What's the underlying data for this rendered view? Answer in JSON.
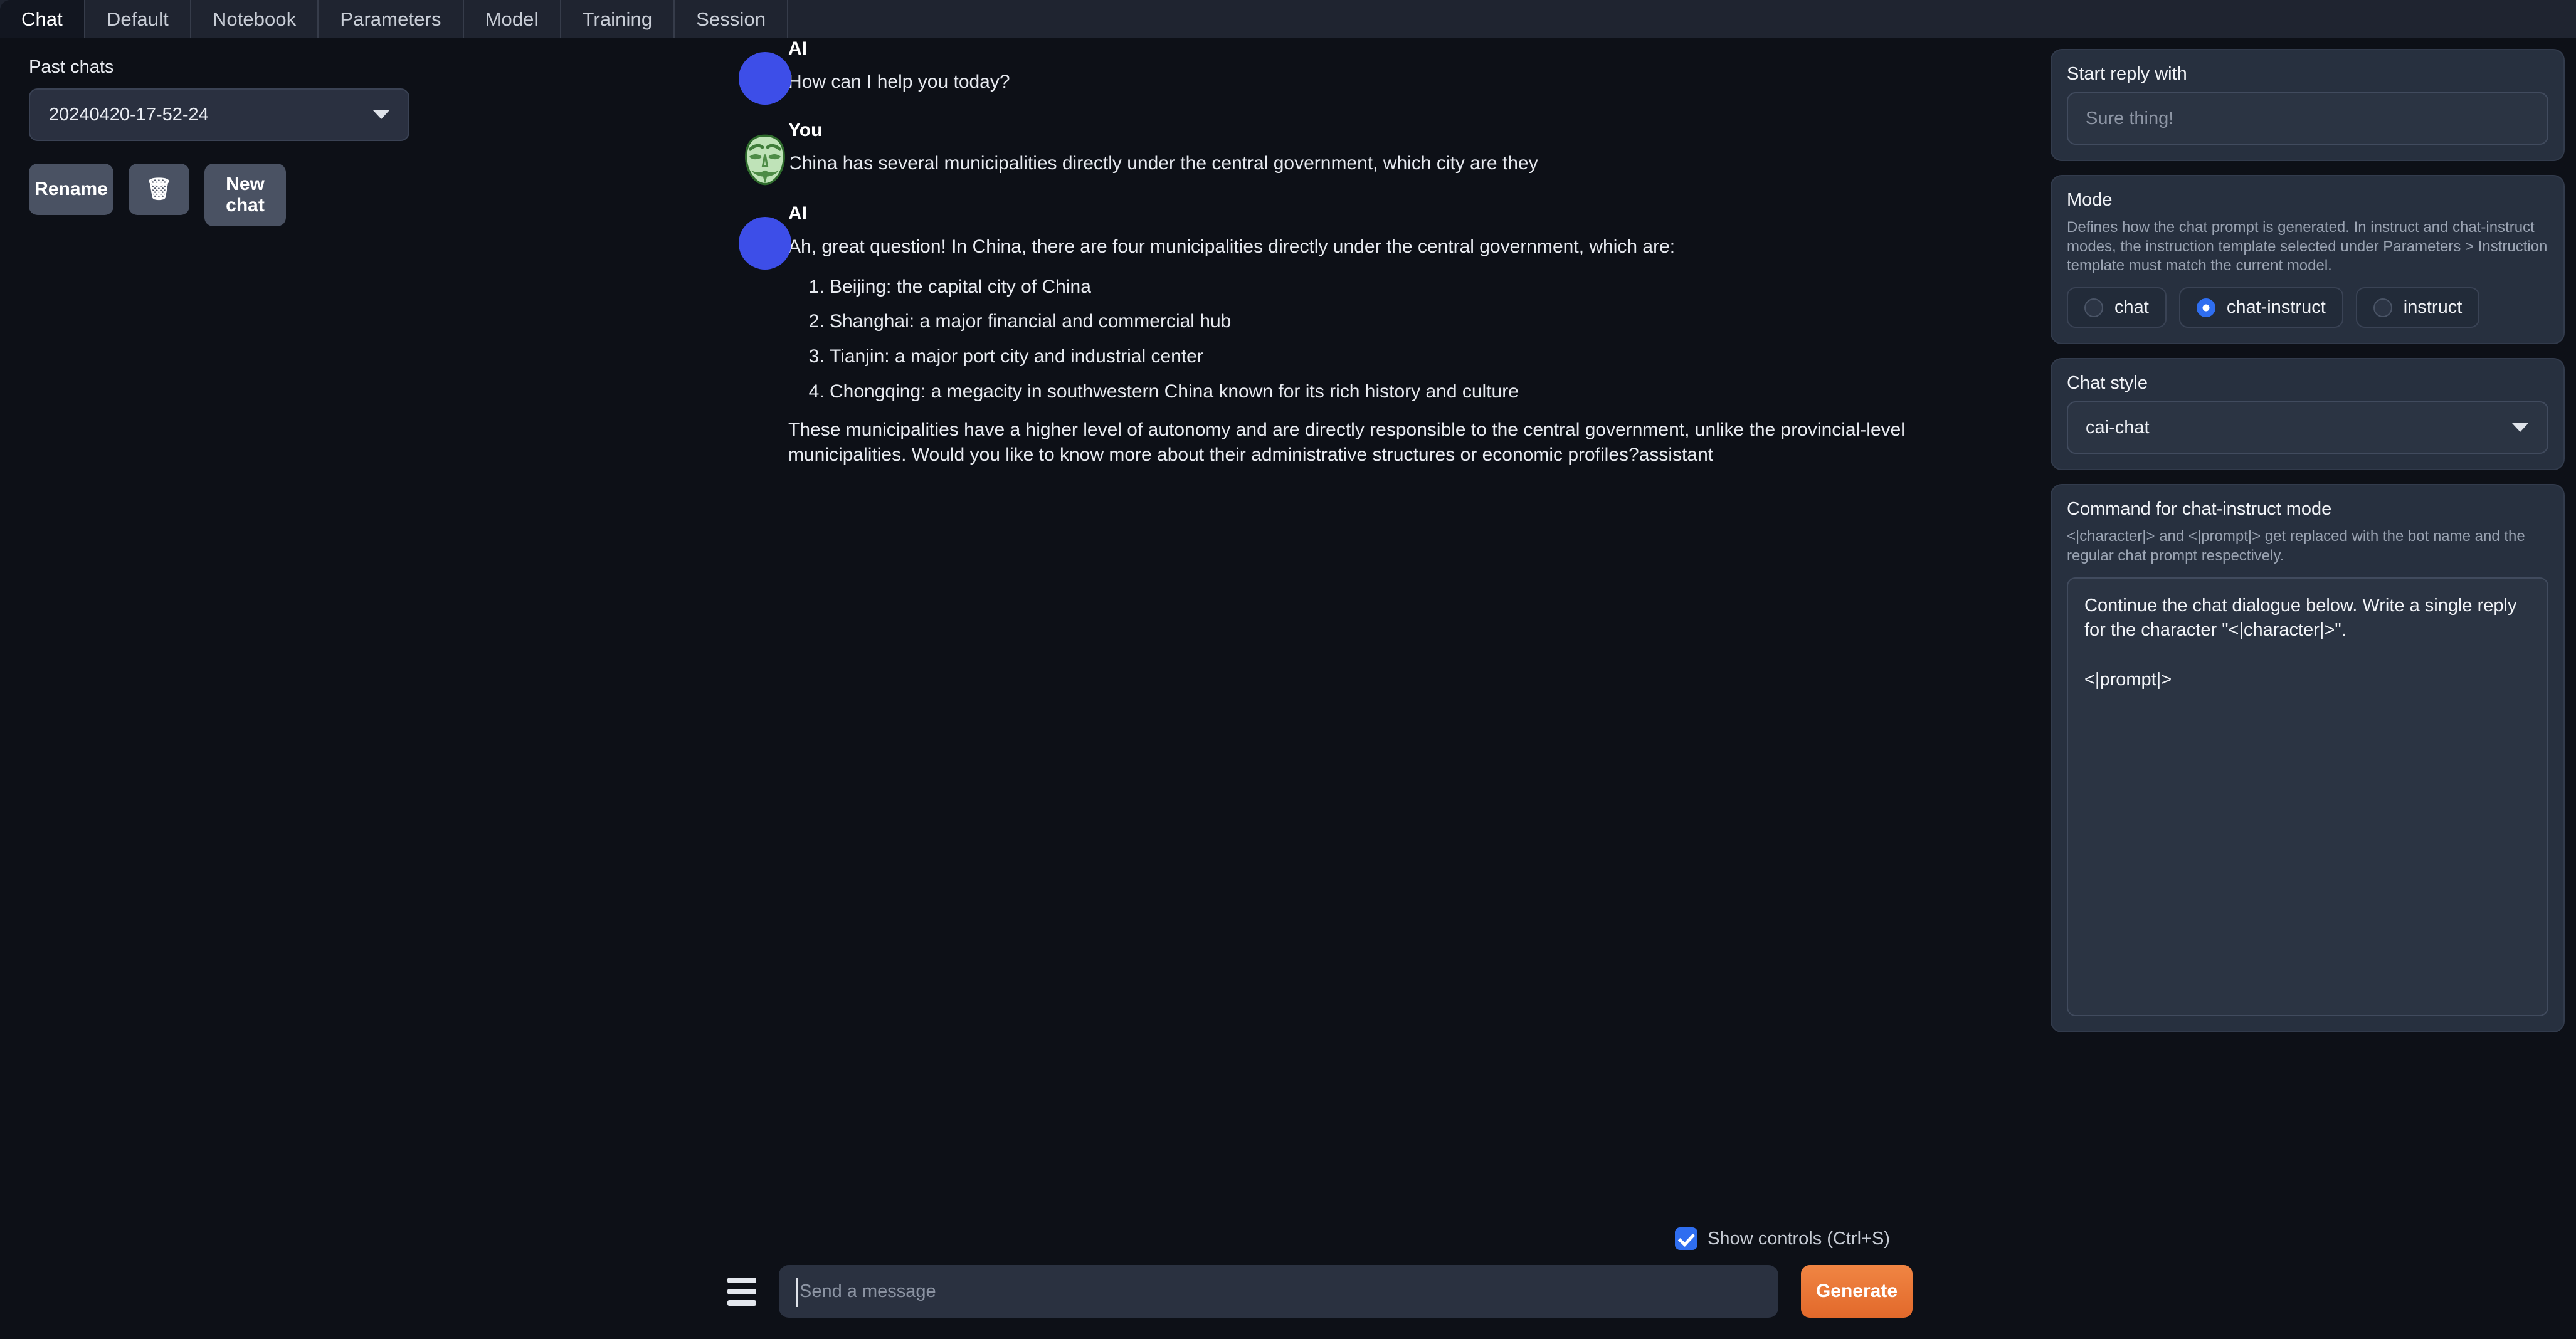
{
  "tabs": [
    {
      "label": "Chat",
      "active": true
    },
    {
      "label": "Default",
      "active": false
    },
    {
      "label": "Notebook",
      "active": false
    },
    {
      "label": "Parameters",
      "active": false
    },
    {
      "label": "Model",
      "active": false
    },
    {
      "label": "Training",
      "active": false
    },
    {
      "label": "Session",
      "active": false
    }
  ],
  "sidebar": {
    "past_chats_label": "Past chats",
    "selected_chat": "20240420-17-52-24",
    "rename_button": "Rename",
    "delete_icon": "🗑",
    "new_chat_button": "New chat"
  },
  "chat": {
    "messages": [
      {
        "name": "AI",
        "avatar": "ai-circle-avatar",
        "paragraphs": [
          "How can I help you today?"
        ],
        "list": []
      },
      {
        "name": "You",
        "avatar": "anonymous-mask-avatar",
        "paragraphs": [
          "China has several municipalities directly under the central government, which city are they"
        ],
        "list": []
      },
      {
        "name": "AI",
        "avatar": "ai-circle-avatar",
        "paragraphs": [
          "Ah, great question! In China, there are four municipalities directly under the central government, which are:",
          "These municipalities have a higher level of autonomy and are directly responsible to the central government, unlike the provincial-level municipalities. Would you like to know more about their administrative structures or economic profiles?assistant"
        ],
        "list": [
          "Beijing: the capital city of China",
          "Shanghai: a major financial and commercial hub",
          "Tianjin: a major port city and industrial center",
          "Chongqing: a megacity in southwestern China known for its rich history and culture"
        ]
      }
    ]
  },
  "right_panel": {
    "start_reply": {
      "title": "Start reply with",
      "value": "",
      "placeholder": "Sure thing!"
    },
    "mode": {
      "title": "Mode",
      "description": "Defines how the chat prompt is generated. In instruct and chat-instruct modes, the instruction template selected under Parameters > Instruction template must match the current model.",
      "options": [
        "chat",
        "chat-instruct",
        "instruct"
      ],
      "selected": "chat-instruct"
    },
    "chat_style": {
      "title": "Chat style",
      "value": "cai-chat"
    },
    "command": {
      "title": "Command for chat-instruct mode",
      "description": "<|character|> and <|prompt|> get replaced with the bot name and the regular chat prompt respectively.",
      "value": "Continue the chat dialogue below. Write a single reply for the character \"<|character|>\".\n\n<|prompt|>"
    }
  },
  "bottom": {
    "show_controls_label": "Show controls (Ctrl+S)",
    "show_controls_checked": true,
    "message_value": "",
    "message_placeholder": "Send a message",
    "generate_button": "Generate",
    "menu_icon": "hamburger-menu-icon"
  },
  "colors": {
    "accent_blue": "#2f6ef0",
    "generate_orange": "#e2692b",
    "ai_avatar": "#3d4ee8",
    "user_avatar_green": "#9fd49a",
    "background": "#0d1017",
    "card": "#27303f"
  }
}
